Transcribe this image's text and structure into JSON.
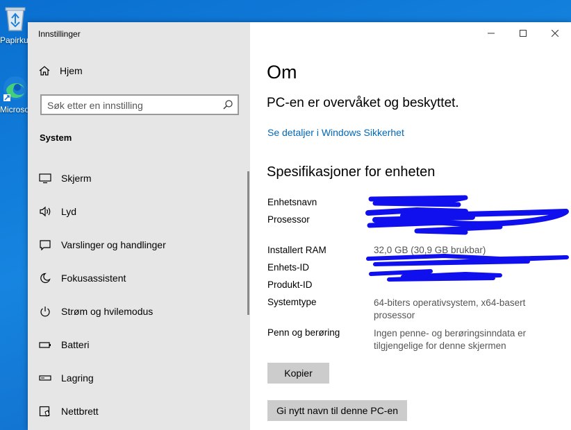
{
  "desktop": {
    "recycle_label": "Papirkurv",
    "edge_label": "Microsoft Edge"
  },
  "window": {
    "title": "Innstillinger",
    "controls": {
      "minimize": "—",
      "maximize": "☐",
      "close": "✕"
    }
  },
  "sidebar": {
    "home_label": "Hjem",
    "search_placeholder": "Søk etter en innstilling",
    "section_title": "System",
    "items": [
      {
        "label": "Skjerm",
        "icon": "monitor-icon"
      },
      {
        "label": "Lyd",
        "icon": "speaker-icon"
      },
      {
        "label": "Varslinger og handlinger",
        "icon": "notification-icon"
      },
      {
        "label": "Fokusassistent",
        "icon": "moon-icon"
      },
      {
        "label": "Strøm og hvilemodus",
        "icon": "power-icon"
      },
      {
        "label": "Batteri",
        "icon": "battery-icon"
      },
      {
        "label": "Lagring",
        "icon": "storage-icon"
      },
      {
        "label": "Nettbrett",
        "icon": "tablet-icon"
      }
    ]
  },
  "main": {
    "title": "Om",
    "protection_status": "PC-en er overvåket og beskyttet.",
    "security_link": "Se detaljer i Windows Sikkerhet",
    "specs_title": "Spesifikasjoner for enheten",
    "specs": [
      {
        "label": "Enhetsnavn",
        "value": ""
      },
      {
        "label": "Prosessor",
        "value": ""
      },
      {
        "label": "Installert RAM",
        "value": "32,0 GB (30,9 GB brukbar)"
      },
      {
        "label": "Enhets-ID",
        "value": ""
      },
      {
        "label": "Produkt-ID",
        "value": ""
      },
      {
        "label": "Systemtype",
        "value": "64-biters operativsystem, x64-basert prosessor"
      },
      {
        "label": "Penn og berøring",
        "value": "Ingen penne- og berøringsinndata er tilgjengelige for denne skjermen"
      }
    ],
    "copy_button": "Kopier",
    "rename_button": "Gi nytt navn til denne PC-en"
  },
  "colors": {
    "link": "#0067b8",
    "redaction": "#1010ee",
    "sidebar_bg": "#e6e6e6"
  }
}
